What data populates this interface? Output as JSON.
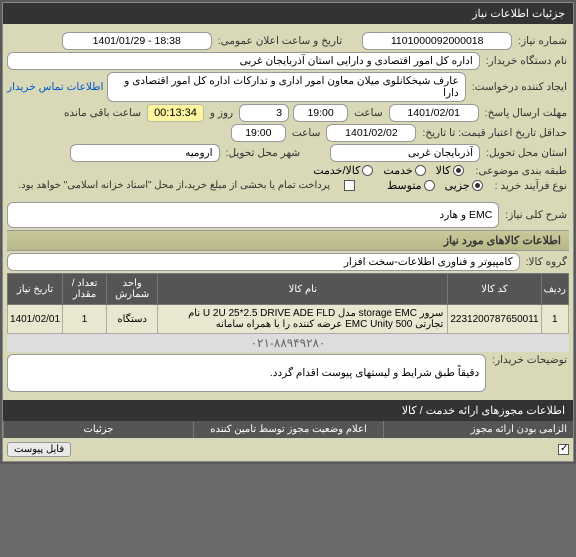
{
  "titlebar": {
    "right": "جزئیات اطلاعات نیاز",
    "left": ""
  },
  "labels": {
    "need_no": "شماره نیاز:",
    "announce_dt": "تاریخ و ساعت اعلان عمومی:",
    "buyer_org": "نام دستگاه خریدار:",
    "requester": "ایجاد کننده درخواست:",
    "contact_link": "اطلاعات تماس خریدار",
    "send_deadline": "مهلت ارسال پاسخ:",
    "date_word": "تاریخ:",
    "hour_word": "ساعت",
    "day_word": "روز و",
    "remaining": "ساعت باقی مانده",
    "min_valid": "حداقل تاریخ اعتبار قیمت: تا تاریخ:",
    "province": "استان محل تحویل:",
    "city": "شهر محل تحویل:",
    "category": "طبقه بندی موضوعی:",
    "goods": "کالا",
    "service": "خدمت",
    "goods_service": "کالا/خدمت",
    "process_type": "نوع فرآیند خرید :",
    "small": "جزیی",
    "medium": "متوسط",
    "payment_note": "پرداخت تمام یا بخشی از مبلغ خرید،از محل \"اسناد خزانه اسلامی\" خواهد بود.",
    "need_title_lbl": "شرح کلی نیاز:",
    "items_info_hdr": "اطلاعات کالاهای مورد نیاز",
    "goods_group_lbl": "گروه کالا:",
    "buyer_notes_lbl": "توضیحات خریدار:",
    "footer": "اطلاعات مجوزهای ارائه خدمت / کالا",
    "col1": "الزامی بودن ارائه مجوز",
    "col2": "اعلام وضعیت مجوز توسط تامین کننده",
    "col3": "جزئیات",
    "attach_btn": "فایل پیوست"
  },
  "values": {
    "need_no": "1101000092000018",
    "announce_dt": "1401/01/29 - 18:38",
    "buyer_org": "اداره کل امور اقتصادی و دارایی استان آذربایجان غربی",
    "requester": "عارف شیخکانلوی میلان معاون امور اداری و تدارکات اداره کل امور اقتصادی و دارا",
    "deadline_date": "1401/02/01",
    "deadline_time": "19:00",
    "deadline_days": "3",
    "countdown": "00:13:34",
    "valid_date": "1401/02/02",
    "valid_time": "19:00",
    "province": "آذربایجان غربی",
    "city": "ارومیه",
    "need_title": "EMC و هارد",
    "goods_group": "کامپیوتر و فناوری اطلاعات-سخت افزار",
    "buyer_notes": "دقیقاً طبق شرایط و لیستهای پیوست اقدام گردد.",
    "phone": "۰۲۱-۸۸۹۴۹۲۸۰"
  },
  "table": {
    "headers": {
      "row": "ردیف",
      "code": "کد کالا",
      "name": "نام کالا",
      "unit": "واحد شمارش",
      "qty": "تعداد / مقدار",
      "date": "تاریخ نیاز"
    },
    "rows": [
      {
        "idx": "1",
        "code": "2231200787650011",
        "name": "سرور storage EMC مدل U 2U 25*2.5 DRIVE ADE FLD نام تجارتی EMC Unity 500 عرضه کننده را با همراه سامانه",
        "unit": "دستگاه",
        "qty": "1",
        "date": "1401/02/01"
      }
    ]
  }
}
